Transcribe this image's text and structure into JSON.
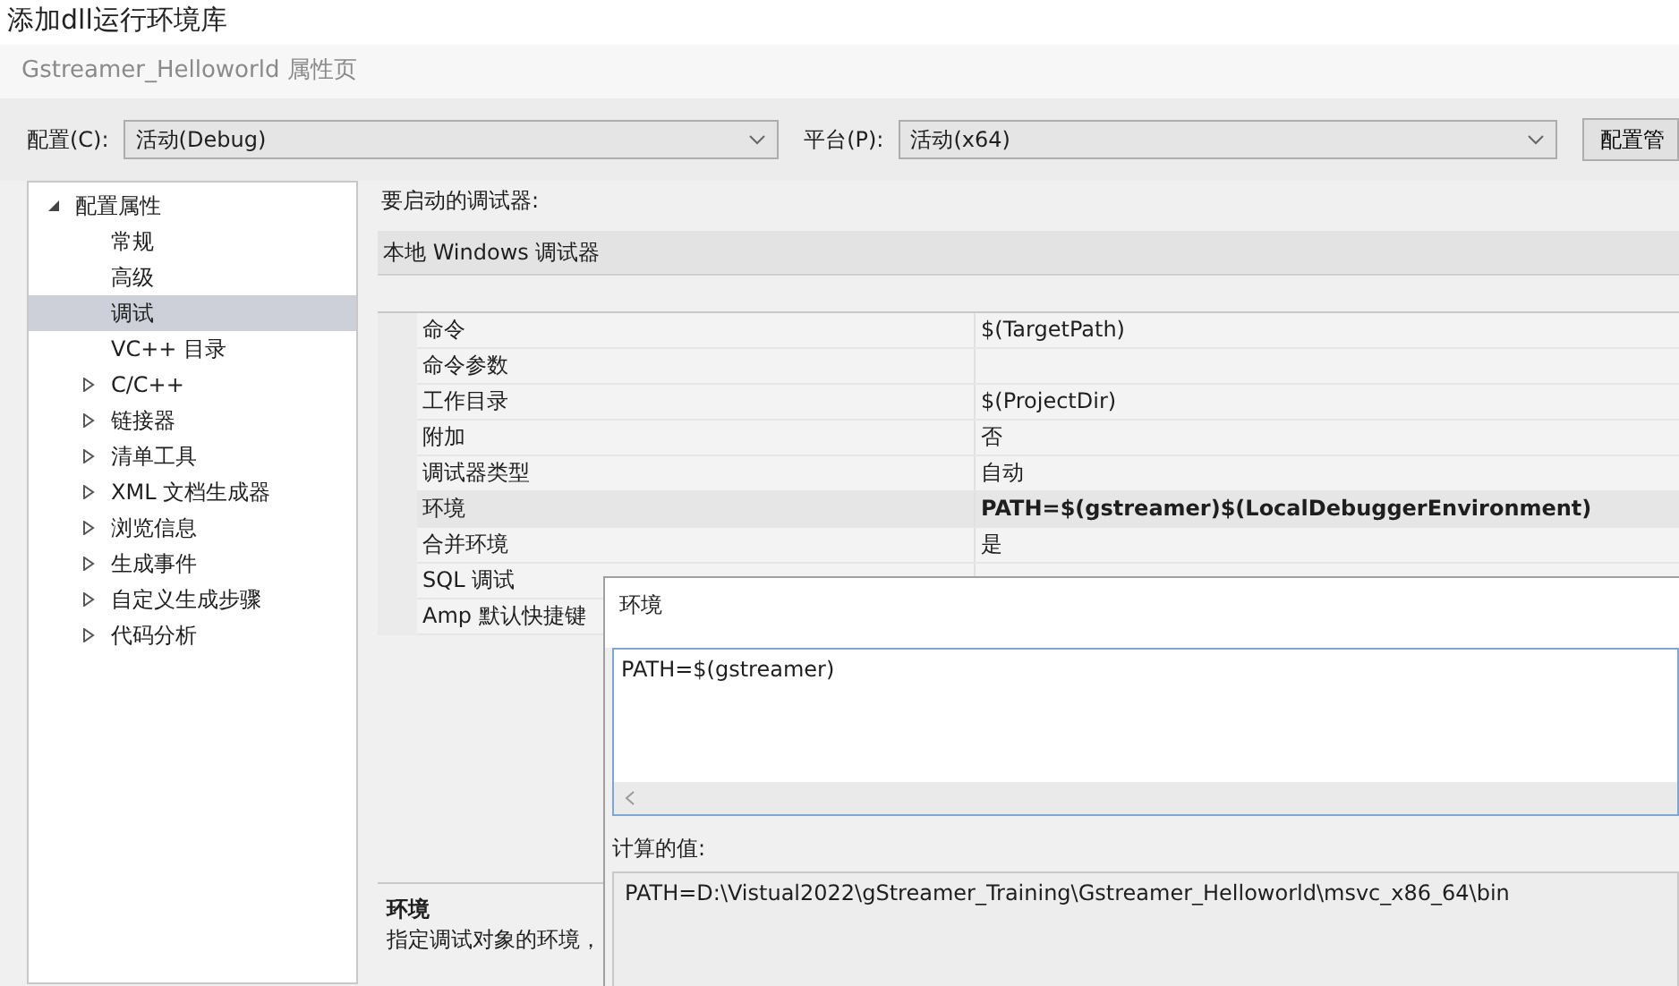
{
  "page_title": "添加dll运行环境库",
  "window": {
    "title": "Gstreamer_Helloworld 属性页"
  },
  "config_bar": {
    "configuration_label": "配置(C):",
    "configuration": "活动(Debug)",
    "platform_label": "平台(P):",
    "platform": "活动(x64)",
    "manager_button": "配置管"
  },
  "tree": [
    {
      "label": "配置属性",
      "kind": "group",
      "expanded": true,
      "selected": false,
      "children": [
        {
          "label": "常规",
          "kind": "leaf",
          "selected": false
        },
        {
          "label": "高级",
          "kind": "leaf",
          "selected": false
        },
        {
          "label": "调试",
          "kind": "leaf",
          "selected": true
        },
        {
          "label": "VC++ 目录",
          "kind": "leaf",
          "selected": false
        },
        {
          "label": "C/C++",
          "kind": "group",
          "expanded": false,
          "selected": false
        },
        {
          "label": "链接器",
          "kind": "group",
          "expanded": false,
          "selected": false
        },
        {
          "label": "清单工具",
          "kind": "group",
          "expanded": false,
          "selected": false
        },
        {
          "label": "XML 文档生成器",
          "kind": "group",
          "expanded": false,
          "selected": false
        },
        {
          "label": "浏览信息",
          "kind": "group",
          "expanded": false,
          "selected": false
        },
        {
          "label": "生成事件",
          "kind": "group",
          "expanded": false,
          "selected": false
        },
        {
          "label": "自定义生成步骤",
          "kind": "group",
          "expanded": false,
          "selected": false
        },
        {
          "label": "代码分析",
          "kind": "group",
          "expanded": false,
          "selected": false
        }
      ]
    }
  ],
  "debugger": {
    "label": "要启动的调试器:",
    "value": "本地 Windows 调试器"
  },
  "properties": [
    {
      "name": "命令",
      "value": "$(TargetPath)",
      "selected": false
    },
    {
      "name": "命令参数",
      "selected": false
    },
    {
      "name": "工作目录",
      "value": "$(ProjectDir)",
      "selected": false
    },
    {
      "name": "附加",
      "value": "否",
      "selected": false
    },
    {
      "name": "调试器类型",
      "value": "自动",
      "selected": false
    },
    {
      "name": "环境",
      "value": "PATH=$(gstreamer)$(LocalDebuggerEnvironment)",
      "selected": true,
      "modified": true
    },
    {
      "name": "合并环境",
      "value": "是",
      "selected": false
    },
    {
      "name": "SQL 调试",
      "selected": false
    },
    {
      "name": "Amp 默认快捷键",
      "selected": false
    }
  ],
  "description": {
    "title": "环境",
    "text": "指定调试对象的环境，"
  },
  "popup": {
    "title": "环境",
    "value": "PATH=$(gstreamer)",
    "evaluated_label": "计算的值:",
    "evaluated_value": "PATH=D:\\Vistual2022\\gStreamer_Training\\Gstreamer_Helloworld\\msvc_x86_64\\bin"
  }
}
